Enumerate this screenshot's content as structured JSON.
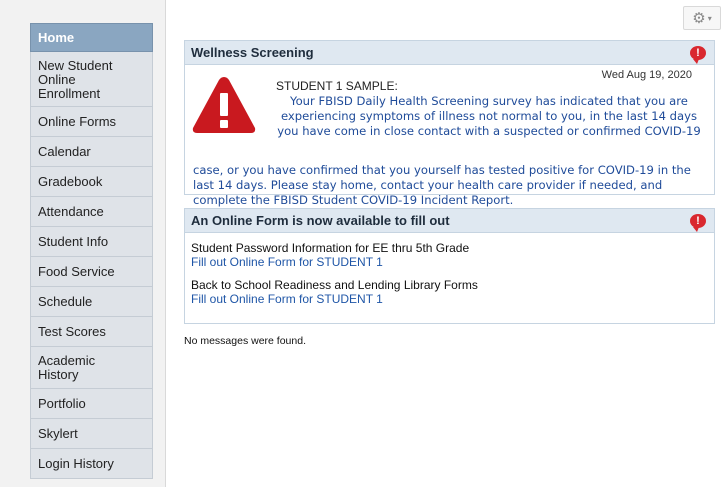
{
  "sidebar": {
    "items": [
      {
        "label": "Home",
        "active": true
      },
      {
        "label": "New Student\nOnline\nEnrollment"
      },
      {
        "label": "Online Forms"
      },
      {
        "label": "Calendar"
      },
      {
        "label": "Gradebook"
      },
      {
        "label": "Attendance"
      },
      {
        "label": "Student Info"
      },
      {
        "label": "Food Service"
      },
      {
        "label": "Schedule"
      },
      {
        "label": "Test Scores"
      },
      {
        "label": "Academic\nHistory"
      },
      {
        "label": "Portfolio"
      },
      {
        "label": "Skylert"
      },
      {
        "label": "Login History"
      }
    ]
  },
  "toolbar": {
    "gear_icon": "gear-icon",
    "caret": "▾"
  },
  "wellness": {
    "title": "Wellness Screening",
    "alert_icon": "!",
    "date": "Wed Aug 19, 2020",
    "student": "STUDENT 1 SAMPLE:",
    "line1": "Your FBISD Daily Health Screening survey has indicated that you are",
    "line2": "experiencing symptoms of illness not normal to you, in the last 14 days",
    "line3": "you have come in close contact with a suspected or confirmed COVID-19",
    "line4": "case, or you have confirmed that you yourself has tested positive for COVID-19 in the last 14 days.  Please stay home, contact your health care provider if needed, and complete the FBISD Student COVID-19 Incident Report."
  },
  "forms": {
    "title": "An Online Form is now available to fill out",
    "alert_icon": "!",
    "entries": [
      {
        "title": "Student Password Information for EE thru 5th Grade",
        "link": "Fill out Online Form for STUDENT 1"
      },
      {
        "title": "Back to School Readiness and Lending Library Forms",
        "link": "Fill out Online Form for STUDENT 1"
      }
    ]
  },
  "messages": {
    "empty_text": "No messages were found."
  }
}
